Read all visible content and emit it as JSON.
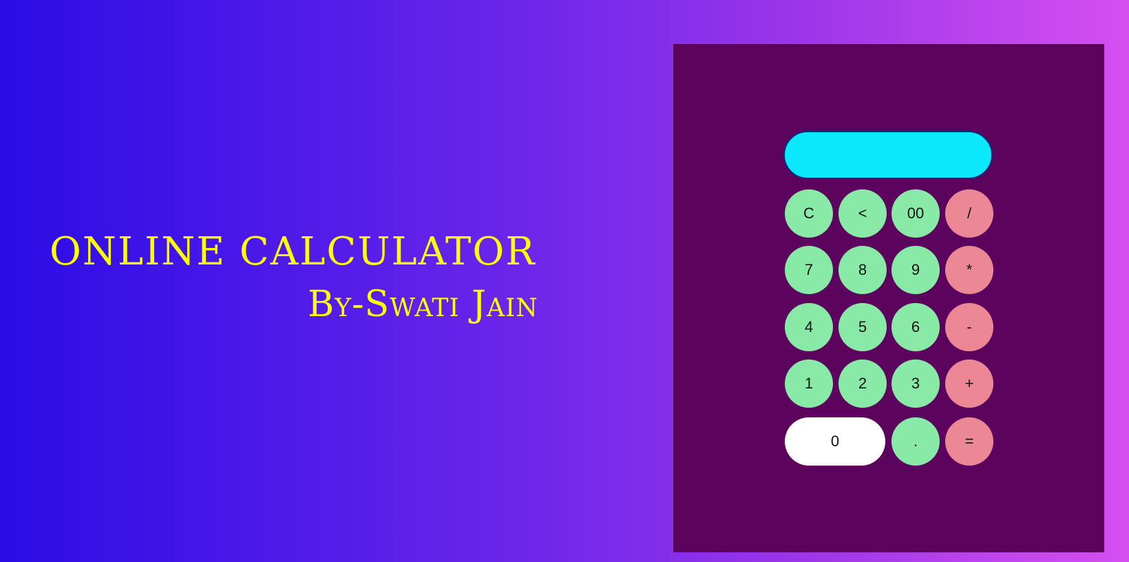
{
  "hero": {
    "title": "ONLINE CALCULATOR",
    "subtitle": "By-Swati Jain"
  },
  "calculator": {
    "display_value": "",
    "keys": {
      "clear": "C",
      "backspace": "<",
      "double_zero": "00",
      "divide": "/",
      "seven": "7",
      "eight": "8",
      "nine": "9",
      "multiply": "*",
      "four": "4",
      "five": "5",
      "six": "6",
      "subtract": "-",
      "one": "1",
      "two": "2",
      "three": "3",
      "add": "+",
      "zero": "0",
      "decimal": ".",
      "equals": "="
    }
  },
  "colors": {
    "background_start": "#2b0ce6",
    "background_end": "#d54ff0",
    "panel": "#5c035d",
    "display": "#0be8fb",
    "number_key": "#88eaa6",
    "operator_key": "#ec8896",
    "zero_key": "#ffffff",
    "heading_text": "#ffff00"
  }
}
